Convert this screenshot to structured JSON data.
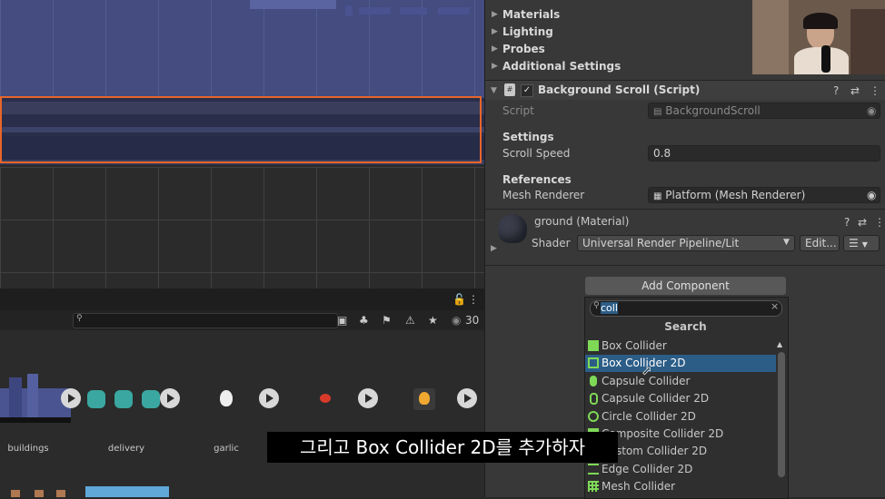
{
  "project": {
    "search_count": "30",
    "assets": [
      {
        "name": "buildings"
      },
      {
        "name": "delivery"
      },
      {
        "name": "garlic"
      },
      {
        "name": ""
      },
      {
        "name": ""
      }
    ]
  },
  "inspector": {
    "foldouts": [
      "Materials",
      "Lighting",
      "Probes",
      "Additional Settings"
    ],
    "component": {
      "title": "Background Scroll (Script)",
      "script_label": "Script",
      "script_value": "BackgroundScroll",
      "settings_header": "Settings",
      "scroll_speed_label": "Scroll Speed",
      "scroll_speed_value": "0.8",
      "references_header": "References",
      "mesh_renderer_label": "Mesh Renderer",
      "mesh_renderer_value": "Platform (Mesh Renderer)"
    },
    "material": {
      "title": "ground (Material)",
      "shader_label": "Shader",
      "shader_value": "Universal Render Pipeline/Lit",
      "edit_label": "Edit..."
    },
    "add_component_label": "Add Component"
  },
  "add_component_dropdown": {
    "search_value": "coll",
    "title": "Search",
    "items": [
      {
        "label": "Box Collider",
        "icon": "box-collider-icon",
        "selected": false
      },
      {
        "label": "Box Collider 2D",
        "icon": "box-collider-2d-icon",
        "selected": true
      },
      {
        "label": "Capsule Collider",
        "icon": "capsule-collider-icon",
        "selected": false
      },
      {
        "label": "Capsule Collider 2D",
        "icon": "capsule-collider-2d-icon",
        "selected": false
      },
      {
        "label": "Circle Collider 2D",
        "icon": "circle-collider-2d-icon",
        "selected": false
      },
      {
        "label": "Composite Collider 2D",
        "icon": "composite-collider-2d-icon",
        "selected": false
      },
      {
        "label": "Custom Collider 2D",
        "icon": "custom-collider-2d-icon",
        "selected": false
      },
      {
        "label": "Edge Collider 2D",
        "icon": "edge-collider-2d-icon",
        "selected": false
      },
      {
        "label": "Mesh Collider",
        "icon": "mesh-collider-icon",
        "selected": false
      }
    ]
  },
  "subtitle": "그리고 Box Collider 2D를 추가하자",
  "colors": {
    "selection_outline": "#e8652a",
    "selected_item": "#2c5d87",
    "collider_icon_green": "#7ed957"
  }
}
